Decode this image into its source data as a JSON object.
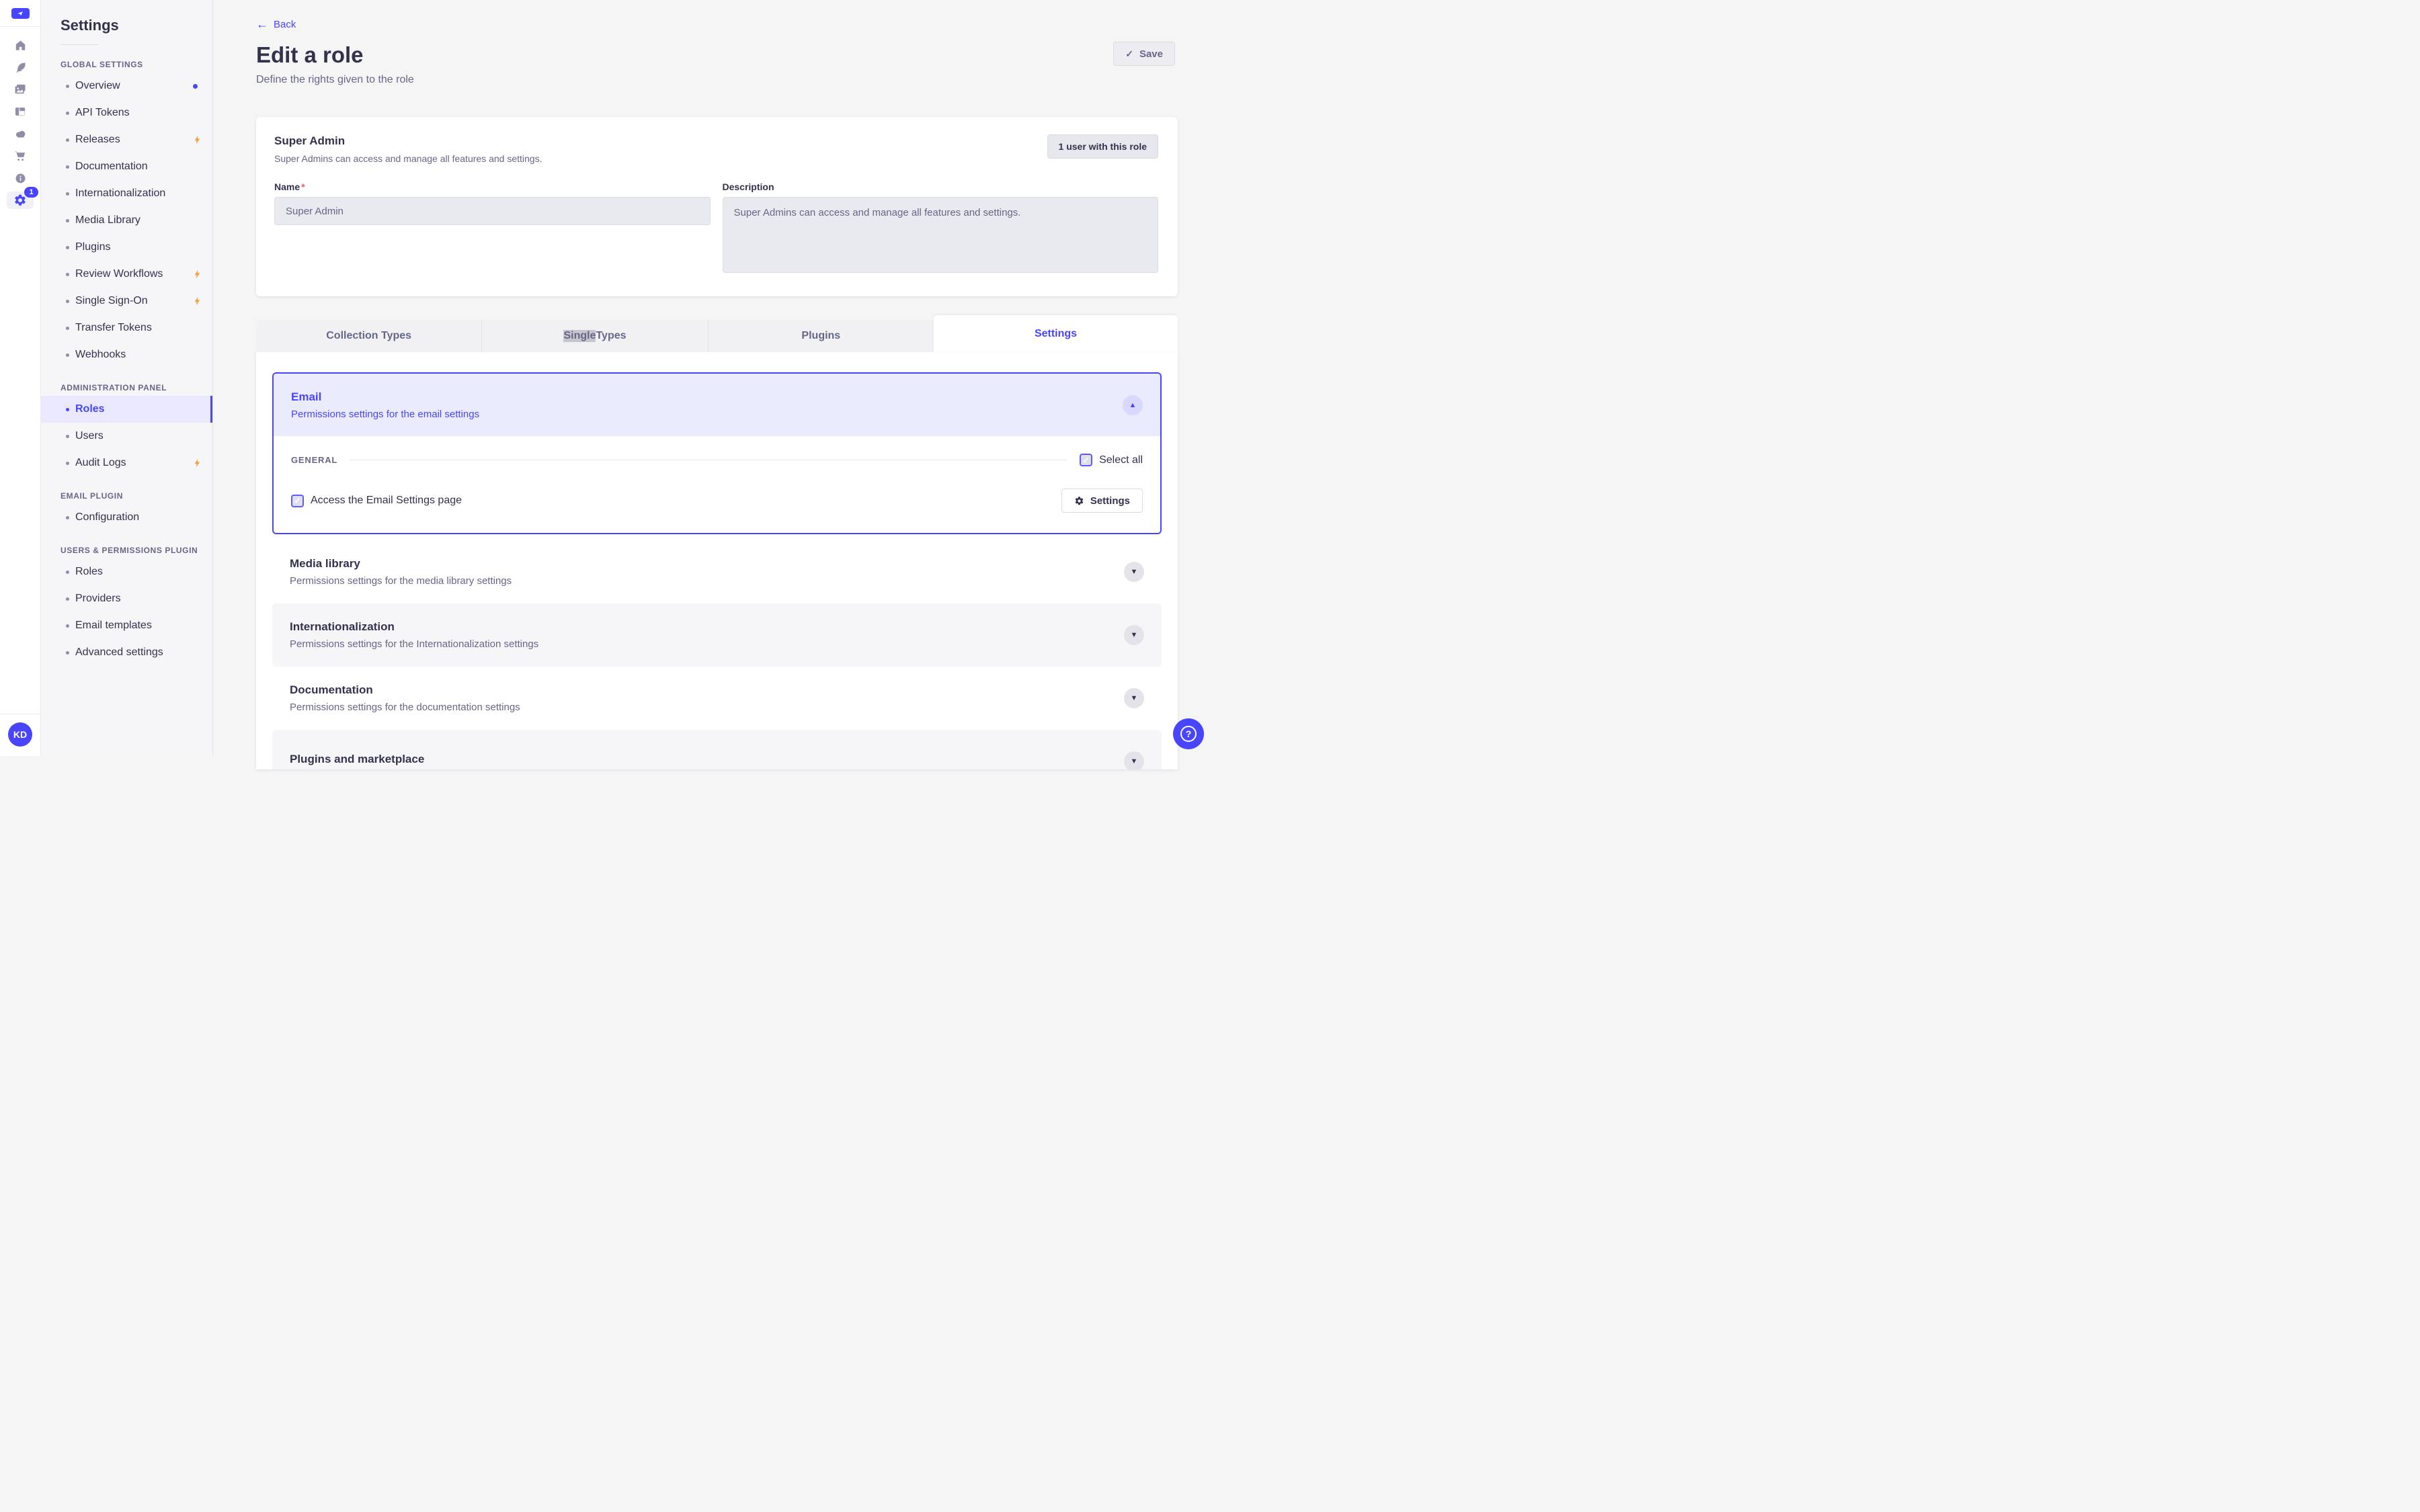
{
  "colors": {
    "accent": "#4945ff",
    "accent_light_bg": "#ebebfe",
    "active_nav_bg": "#e9e8ff",
    "bolt": "#f0a33f",
    "danger": "#ee5e52",
    "text_dark": "#32324d",
    "text_muted": "#666687",
    "selection_highlight": "#c6c6d0"
  },
  "rail": {
    "icons": [
      "home-icon",
      "content-manager-feather-icon",
      "media-library-icon",
      "content-type-builder-icon",
      "cloud-icon",
      "marketplace-cart-icon",
      "info-icon",
      "settings-gear-icon"
    ],
    "settings_badge": "1",
    "avatar_initials": "KD"
  },
  "sidebar": {
    "title": "Settings",
    "sections": [
      {
        "label": "GLOBAL SETTINGS",
        "items": [
          {
            "label": "Overview",
            "dot": true
          },
          {
            "label": "API Tokens"
          },
          {
            "label": "Releases",
            "bolt": true
          },
          {
            "label": "Documentation"
          },
          {
            "label": "Internationalization"
          },
          {
            "label": "Media Library"
          },
          {
            "label": "Plugins"
          },
          {
            "label": "Review Workflows",
            "bolt": true
          },
          {
            "label": "Single Sign-On",
            "bolt": true
          },
          {
            "label": "Transfer Tokens"
          },
          {
            "label": "Webhooks"
          }
        ]
      },
      {
        "label": "ADMINISTRATION PANEL",
        "items": [
          {
            "label": "Roles",
            "active": true
          },
          {
            "label": "Users"
          },
          {
            "label": "Audit Logs",
            "bolt": true
          }
        ]
      },
      {
        "label": "EMAIL PLUGIN",
        "items": [
          {
            "label": "Configuration"
          }
        ]
      },
      {
        "label": "USERS & PERMISSIONS PLUGIN",
        "items": [
          {
            "label": "Roles"
          },
          {
            "label": "Providers"
          },
          {
            "label": "Email templates"
          },
          {
            "label": "Advanced settings"
          }
        ]
      }
    ]
  },
  "header": {
    "back": "Back",
    "title": "Edit a role",
    "subtitle": "Define the rights given to the role",
    "save_label": "Save"
  },
  "role_card": {
    "title": "Super Admin",
    "subtitle": "Super Admins can access and manage all features and settings.",
    "users_button": "1 user with this role",
    "name_label": "Name",
    "required_mark": "*",
    "name_value": "Super Admin",
    "description_label": "Description",
    "description_value": "Super Admins can access and manage all features and settings."
  },
  "tabs": {
    "t0": {
      "label": "Collection Types"
    },
    "t1": {
      "highlight": "Single",
      "rest": " Types"
    },
    "t2": {
      "label": "Plugins"
    },
    "t3": {
      "label": "Settings",
      "active": true
    }
  },
  "permissions": {
    "email": {
      "title": "Email",
      "subtitle": "Permissions settings for the email settings",
      "section_label": "GENERAL",
      "select_all_label": "Select all",
      "checkbox_label": "Access the Email Settings page",
      "settings_button": "Settings"
    },
    "collapsed": [
      {
        "title": "Media library",
        "subtitle": "Permissions settings for the media library settings"
      },
      {
        "title": "Internationalization",
        "subtitle": "Permissions settings for the Internationalization settings"
      },
      {
        "title": "Documentation",
        "subtitle": "Permissions settings for the documentation settings"
      },
      {
        "title": "Plugins and marketplace",
        "subtitle": ""
      }
    ]
  }
}
